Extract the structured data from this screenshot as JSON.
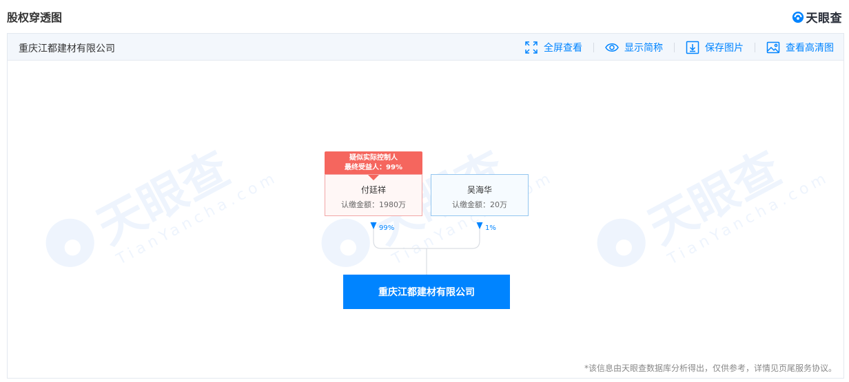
{
  "header": {
    "title": "股权穿透图",
    "brand_name": "天眼查"
  },
  "toolbar": {
    "company_name": "重庆江都建材有限公司",
    "actions": [
      {
        "label": "全屏查看",
        "icon": "fullscreen-icon"
      },
      {
        "label": "显示简称",
        "icon": "eye-icon"
      },
      {
        "label": "保存图片",
        "icon": "download-icon"
      },
      {
        "label": "查看高清图",
        "icon": "image-icon"
      }
    ]
  },
  "chart": {
    "controller_tag": {
      "line1": "疑似实际控制人",
      "line2": "最终受益人：99%"
    },
    "shareholders": [
      {
        "name": "付廷祥",
        "amount": "认缴金额：1980万",
        "percent": "99%"
      },
      {
        "name": "吴海华",
        "amount": "认缴金额：20万",
        "percent": "1%"
      }
    ],
    "target": "重庆江都建材有限公司"
  },
  "watermark": {
    "text": "天眼查",
    "sub": "TianYancha.com"
  },
  "footnote": "*该信息由天眼查数据库分析得出，仅供参考，详情见页尾服务协议。",
  "colors": {
    "accent": "#0084ff",
    "controller": "#f5665e"
  }
}
